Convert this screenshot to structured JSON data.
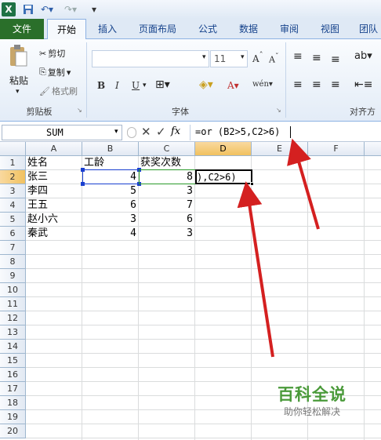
{
  "qat": {
    "excel_icon": "excel-icon",
    "undo_icon": "undo-icon",
    "redo_icon": "redo-icon"
  },
  "tabs": [
    "文件",
    "开始",
    "插入",
    "页面布局",
    "公式",
    "数据",
    "审阅",
    "视图",
    "团队"
  ],
  "ribbon": {
    "paste": "粘贴",
    "cut": "剪切",
    "copy": "复制",
    "format_painter": "格式刷",
    "clipboard": "剪贴板",
    "font_size": "11",
    "font_group": "字体",
    "align_group": "对齐方"
  },
  "formula_bar": {
    "name_box": "SUM",
    "formula": "=or (B2>5,C2>6)"
  },
  "columns": [
    "A",
    "B",
    "C",
    "D",
    "E",
    "F"
  ],
  "rows": [
    "1",
    "2",
    "3",
    "4",
    "5",
    "6",
    "7",
    "8",
    "9",
    "10",
    "11",
    "12",
    "13",
    "14",
    "15",
    "16",
    "17",
    "18",
    "19",
    "20"
  ],
  "cells": {
    "A1": "姓名",
    "B1": "工龄",
    "C1": "获奖次数",
    "A2": "张三",
    "B2": "4",
    "C2": "8",
    "D2": "),C2>6)",
    "A3": "李四",
    "B3": "5",
    "C3": "3",
    "A4": "王五",
    "B4": "6",
    "C4": "7",
    "A5": "赵小六",
    "B5": "3",
    "C5": "6",
    "A6": "秦武",
    "B6": "4",
    "C6": "3"
  },
  "watermark": {
    "title": "百科全说",
    "subtitle": "助你轻松解决"
  },
  "colors": {
    "file_tab": "#2a6f2a",
    "arrow": "#d42020",
    "selection": "#1a3fd0"
  }
}
